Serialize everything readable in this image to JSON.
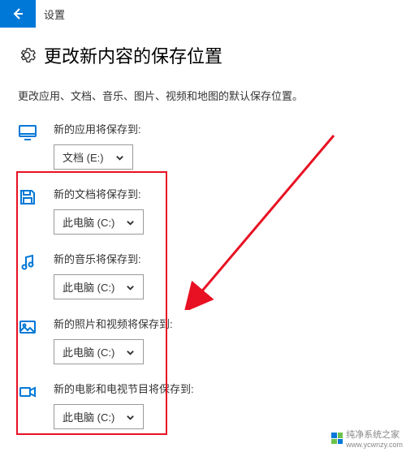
{
  "titlebar": {
    "label": "设置"
  },
  "page": {
    "heading": "更改新内容的保存位置",
    "subtitle": "更改应用、文档、音乐、图片、视频和地图的默认保存位置。"
  },
  "items": {
    "apps": {
      "label": "新的应用将保存到:",
      "value": "文档 (E:)"
    },
    "docs": {
      "label": "新的文档将保存到:",
      "value": "此电脑 (C:)"
    },
    "music": {
      "label": "新的音乐将保存到:",
      "value": "此电脑 (C:)"
    },
    "photos": {
      "label": "新的照片和视频将保存到:",
      "value": "此电脑 (C:)"
    },
    "movies": {
      "label": "新的电影和电视节目将保存到:",
      "value": "此电脑 (C:)"
    }
  },
  "watermark": {
    "text": "纯净系统之家",
    "url": "www.ycwnzy.com"
  }
}
